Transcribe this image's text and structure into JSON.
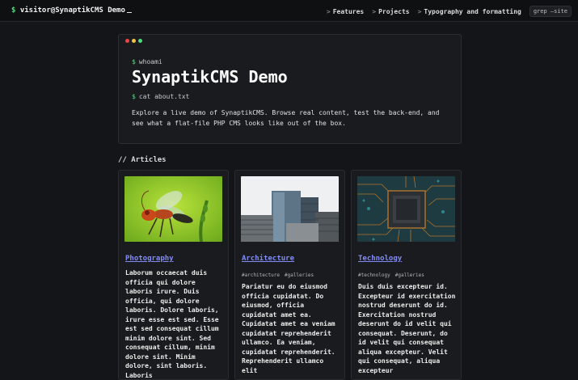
{
  "header": {
    "brand": "visitor@SynaptikCMS Demo",
    "brand_prompt": "$",
    "nav": [
      {
        "label": "Features"
      },
      {
        "label": "Projects"
      },
      {
        "label": "Typography and formatting"
      }
    ],
    "nav_prefix": ">",
    "search_label": "grep —site"
  },
  "hero": {
    "cmd1": "whoami",
    "title": "SynaptikCMS Demo",
    "cmd2": "cat about.txt",
    "prompt": "$",
    "description": "Explore a live demo of SynaptikCMS. Browse real content, test the back-end, and see what a flat-file PHP CMS looks like out of the box."
  },
  "articles": {
    "heading": "// Articles",
    "items": [
      {
        "title": "Photography",
        "tags": [],
        "excerpt": "Laborum occaecat duis officia qui dolore laboris irure. Duis officia, qui dolore laboris. Dolore laboris, irure esse est sed. Esse est sed consequat cillum minim dolore sint. Sed consequat cillum, minim dolore sint. Minim dolore, sint laboris. Laboris"
      },
      {
        "title": "Architecture",
        "tags": [
          "#architecture",
          "#galleries"
        ],
        "excerpt": "Pariatur eu do eiusmod officia cupidatat. Do eiusmod, officia cupidatat amet ea. Cupidatat amet ea veniam cupidatat reprehenderit ullamco. Ea veniam, cupidatat reprehenderit. Reprehenderit ullamco elit"
      },
      {
        "title": "Technology",
        "tags": [
          "#technology",
          "#galleries"
        ],
        "excerpt": "Duis duis excepteur id. Excepteur id exercitation nostrud deserunt do id. Exercitation nostrud deserunt do id velit qui consequat. Deserunt, do id velit qui consequat aliqua excepteur. Velit qui consequat, aliqua excepteur"
      }
    ]
  },
  "colors": {
    "background": "#141518",
    "accent_green": "#4ade80",
    "link": "#818cf8"
  }
}
